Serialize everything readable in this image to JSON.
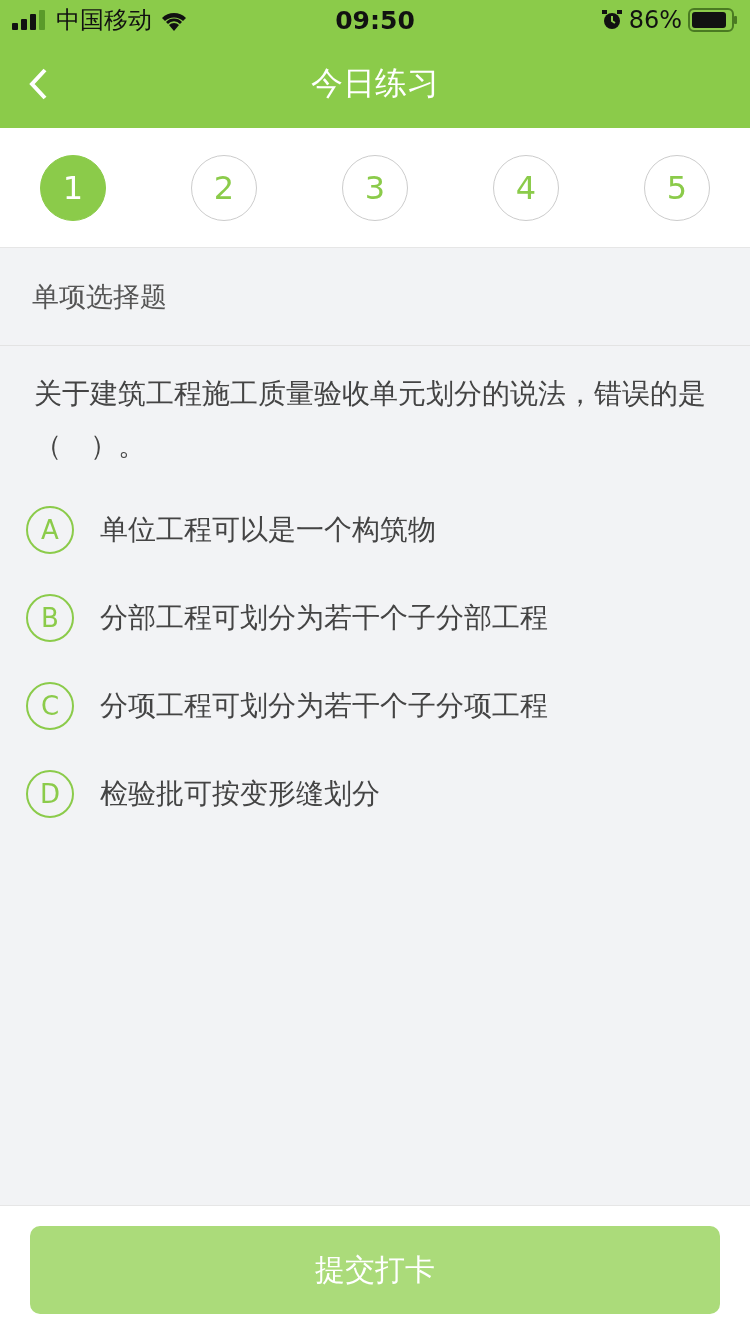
{
  "status_bar": {
    "carrier": "中国移动",
    "time": "09:50",
    "battery": "86%"
  },
  "nav": {
    "title": "今日练习"
  },
  "steps": [
    {
      "label": "1",
      "selected": true
    },
    {
      "label": "2",
      "selected": false
    },
    {
      "label": "3",
      "selected": false
    },
    {
      "label": "4",
      "selected": false
    },
    {
      "label": "5",
      "selected": false
    }
  ],
  "section": {
    "title": "单项选择题"
  },
  "question": {
    "text": "关于建筑工程施工质量验收单元划分的说法，错误的是（　）。",
    "options": [
      {
        "letter": "A",
        "text": "单位工程可以是一个构筑物",
        "selected": false
      },
      {
        "letter": "B",
        "text": "分部工程可划分为若干个子分部工程",
        "selected": false
      },
      {
        "letter": "C",
        "text": "分项工程可划分为若干个子分项工程",
        "selected": false
      },
      {
        "letter": "D",
        "text": "检验批可按变形缝划分",
        "selected": false
      }
    ]
  },
  "submit": {
    "label": "提交打卡",
    "disabled": true
  }
}
